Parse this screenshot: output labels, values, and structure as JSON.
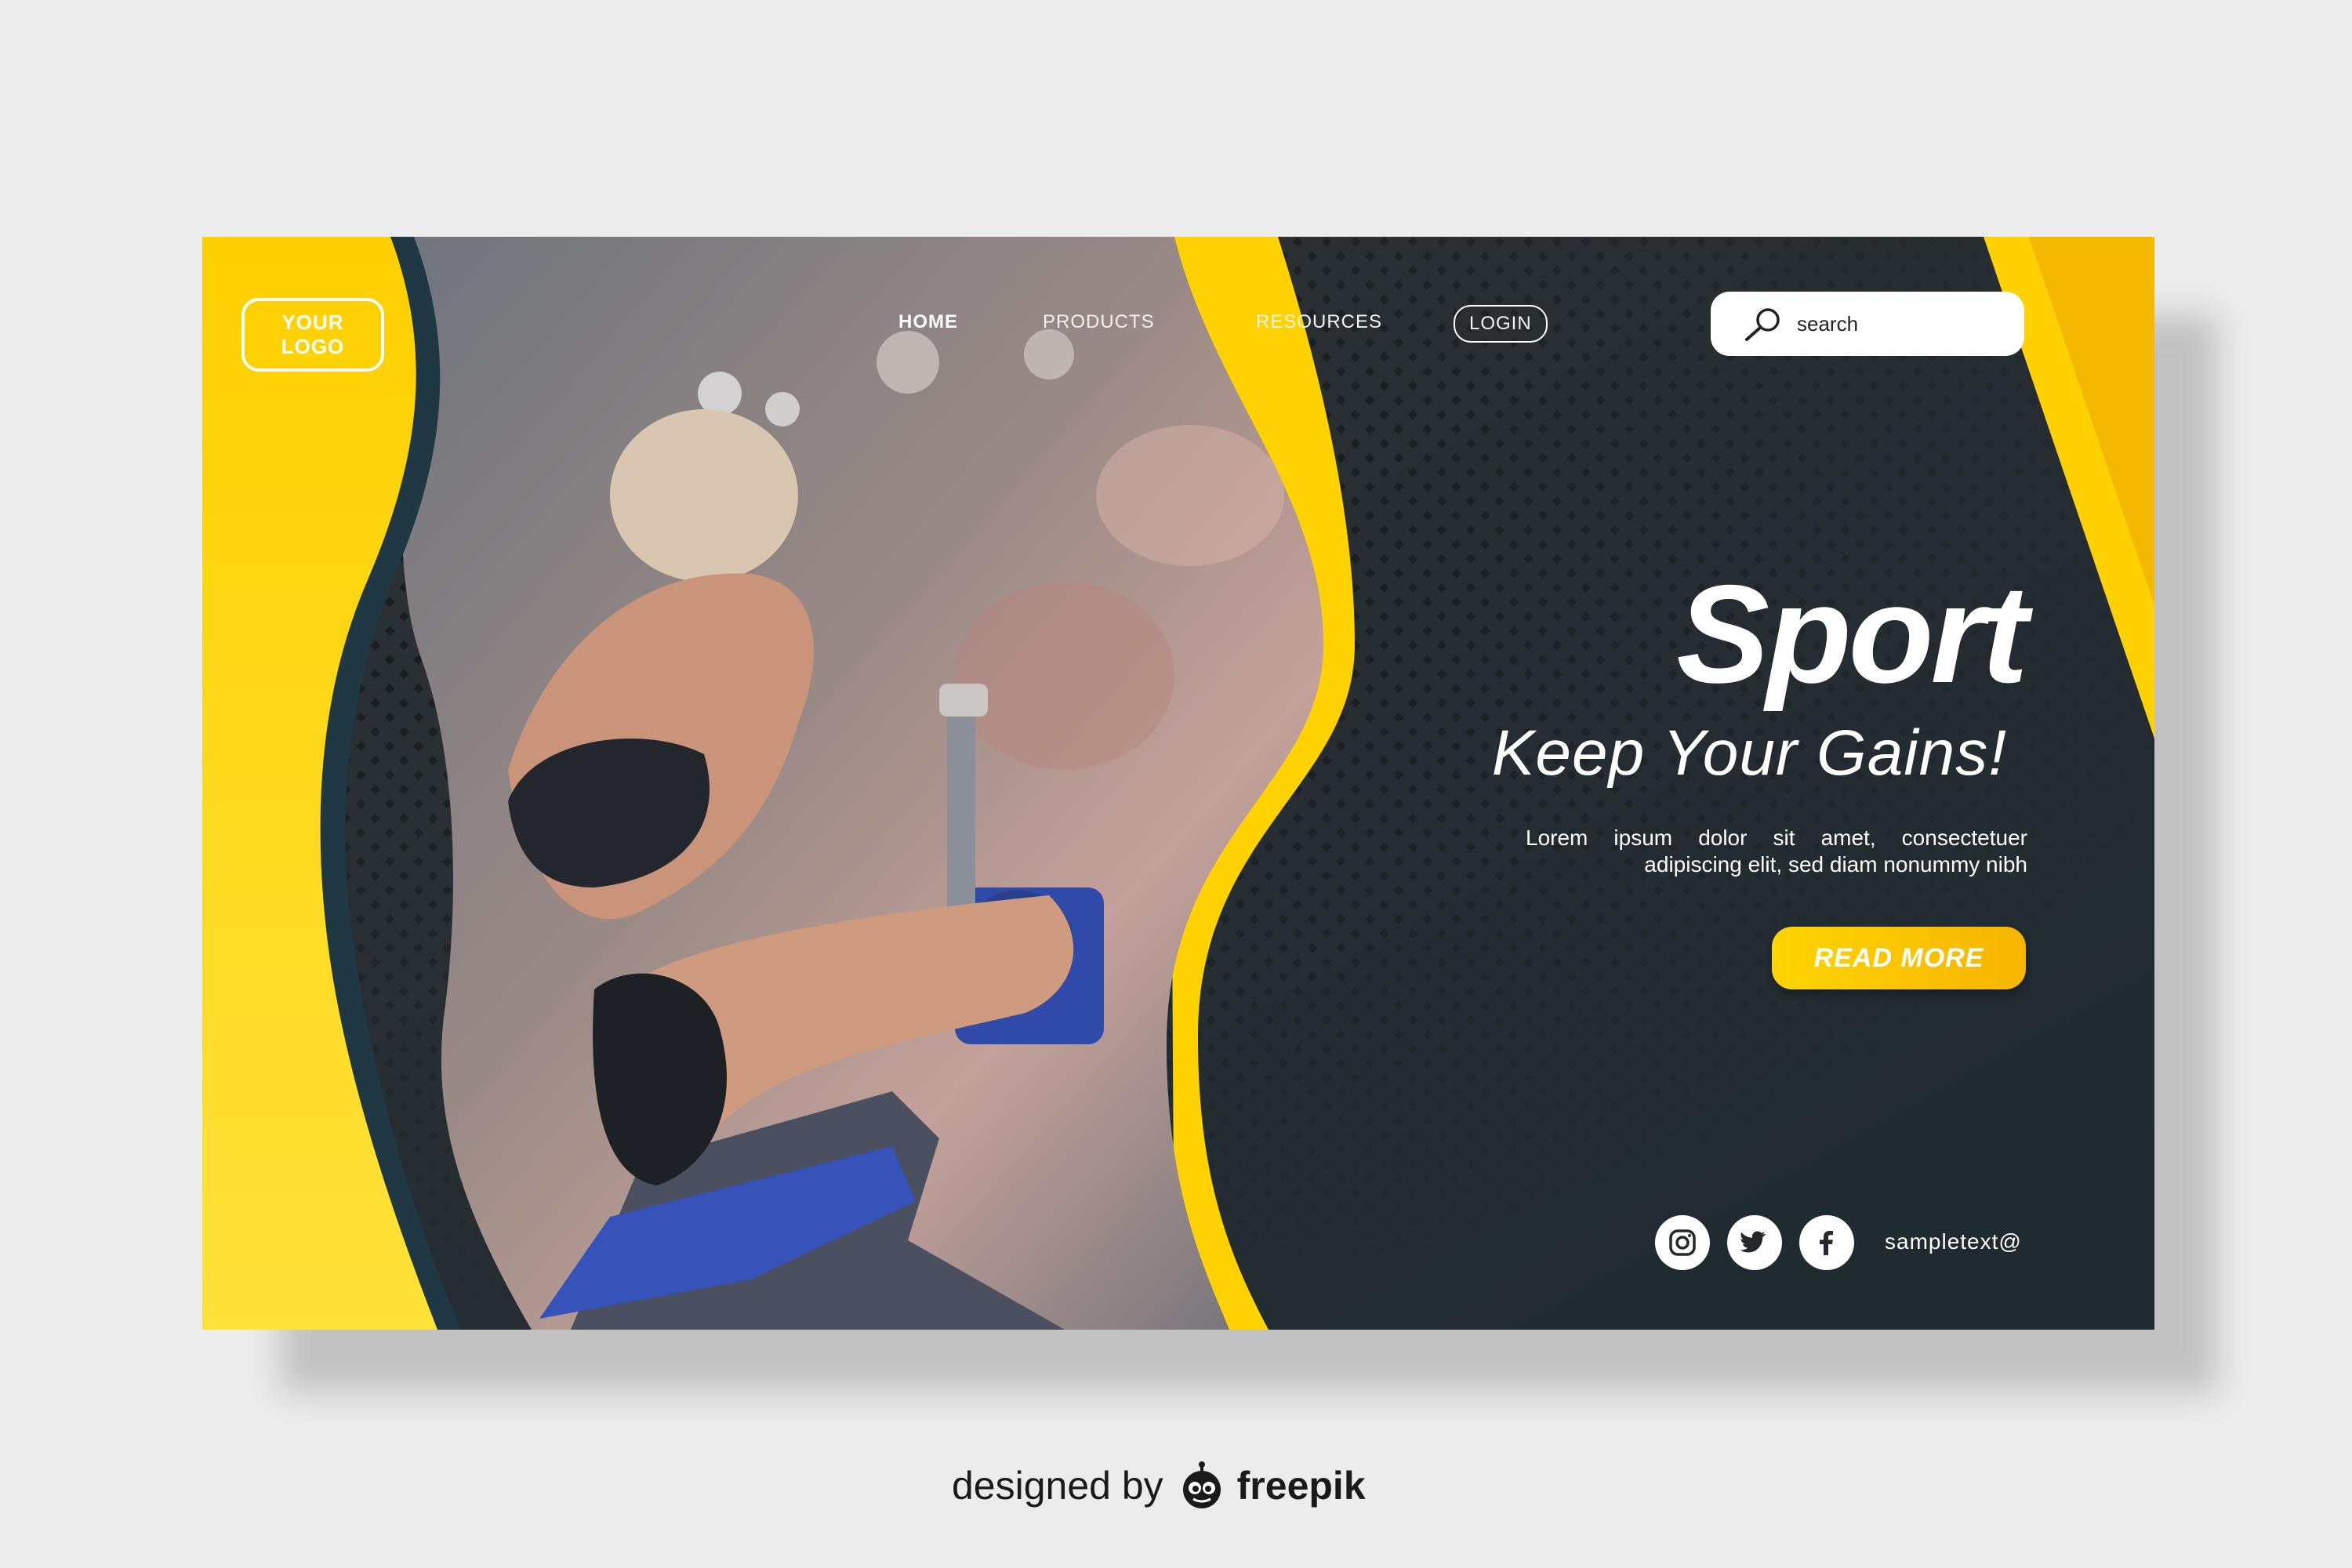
{
  "brand": {
    "logo_line1": "YOUR",
    "logo_line2": "LOGO"
  },
  "nav": {
    "home": "HOME",
    "products": "PRODUCTS",
    "resources": "RESOURCES",
    "login": "LOGIN"
  },
  "search": {
    "placeholder": "search"
  },
  "hero": {
    "title": "Sport",
    "subtitle": "Keep Your Gains!",
    "body": "Lorem ipsum dolor sit amet, consectetuer adipiscing elit, sed diam nonummy nibh",
    "cta": "READ MORE"
  },
  "footer": {
    "contact": "sampletext@"
  },
  "social_icons": [
    "instagram-icon",
    "twitter-icon",
    "facebook-icon"
  ],
  "credit": {
    "prefix": "designed by",
    "brand": "freepik"
  },
  "colors": {
    "accent": "#ffcd00",
    "dark": "#22282b",
    "background": "#ececed"
  }
}
